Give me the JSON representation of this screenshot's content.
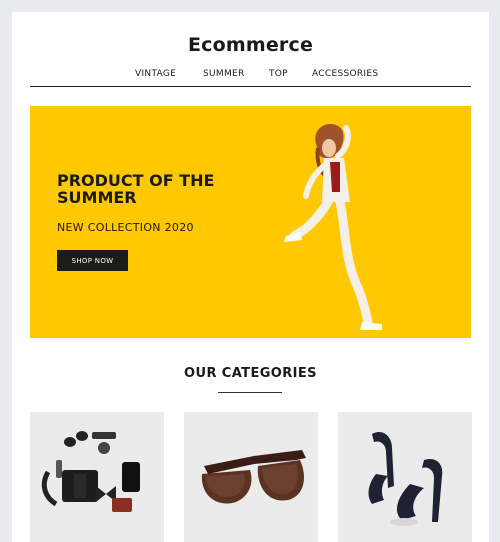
{
  "brand": "Ecommerce",
  "nav": [
    "VINTAGE",
    "SUMMER",
    "TOP",
    "ACCESSORIES"
  ],
  "hero": {
    "title": "PRODUCT OF THE SUMMER",
    "subtitle": "NEW COLLECTION 2020",
    "button": "SHOP NOW",
    "background": "#ffc800"
  },
  "categories": {
    "title": "OUR CATEGORIES",
    "items": [
      {
        "icon": "accessories-flatlay-image"
      },
      {
        "icon": "sunglasses-image"
      },
      {
        "icon": "high-heels-image"
      }
    ]
  }
}
